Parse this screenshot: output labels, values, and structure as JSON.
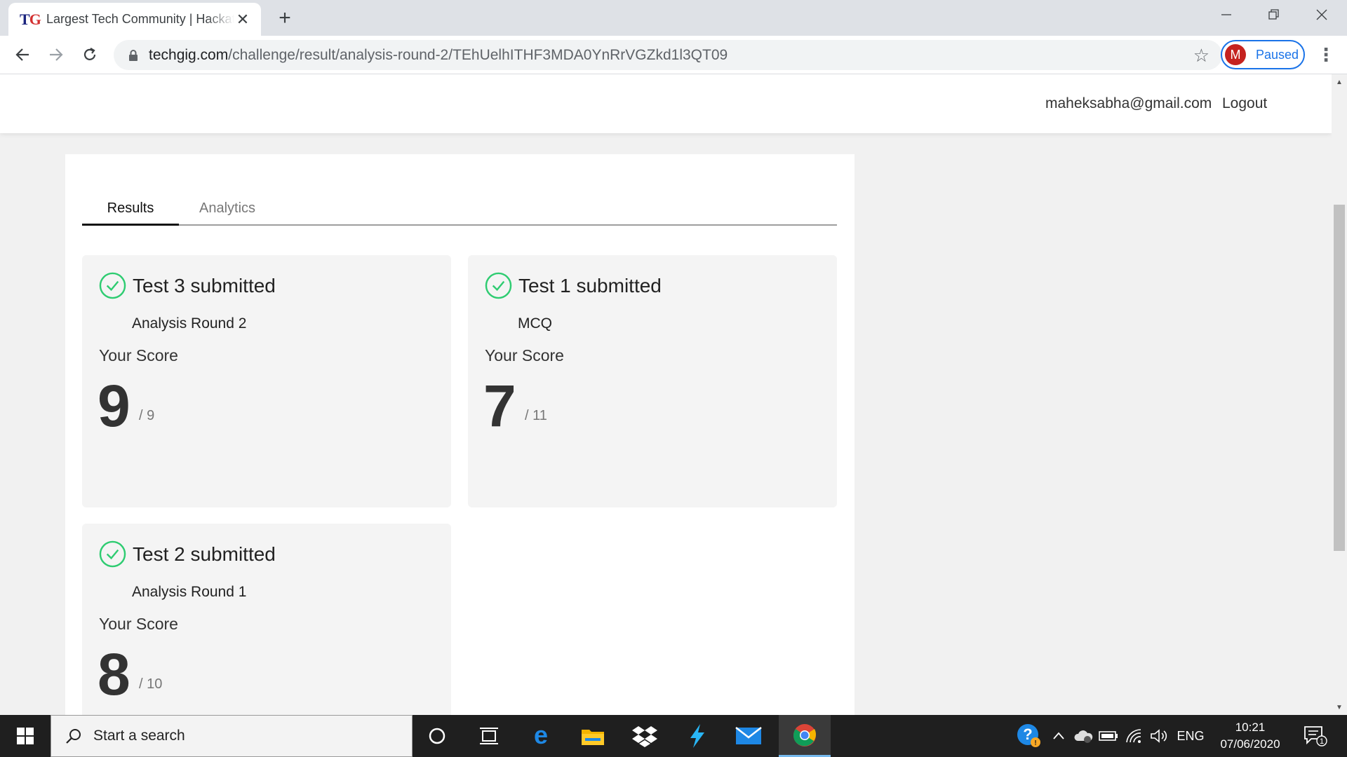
{
  "browser": {
    "tab_title": "Largest Tech Community | Hackathon",
    "url_domain": "techgig.com",
    "url_path": "/challenge/result/analysis-round-2/TEhUelhITHF3MDA0YnRrVGZkd1l3QT09",
    "profile_initial": "M",
    "profile_status": "Paused"
  },
  "header": {
    "email": "maheksabha@gmail.com",
    "logout": "Logout"
  },
  "tabs": {
    "results": "Results",
    "analytics": "Analytics"
  },
  "score_label": "Your Score",
  "cards": [
    {
      "title": "Test 3 submitted",
      "subtitle": "Analysis Round 2",
      "score": "9",
      "total": "/ 9"
    },
    {
      "title": "Test 1 submitted",
      "subtitle": "MCQ",
      "score": "7",
      "total": "/ 11"
    },
    {
      "title": "Test 2 submitted",
      "subtitle": "Analysis Round 1",
      "score": "8",
      "total": "/ 10"
    }
  ],
  "taskbar": {
    "search_placeholder": "Start a search",
    "language": "ENG",
    "time": "10:21",
    "date": "07/06/2020",
    "notification_count": "1"
  },
  "colors": {
    "check_green": "#2ecc71",
    "accent_blue": "#1a73e8"
  }
}
